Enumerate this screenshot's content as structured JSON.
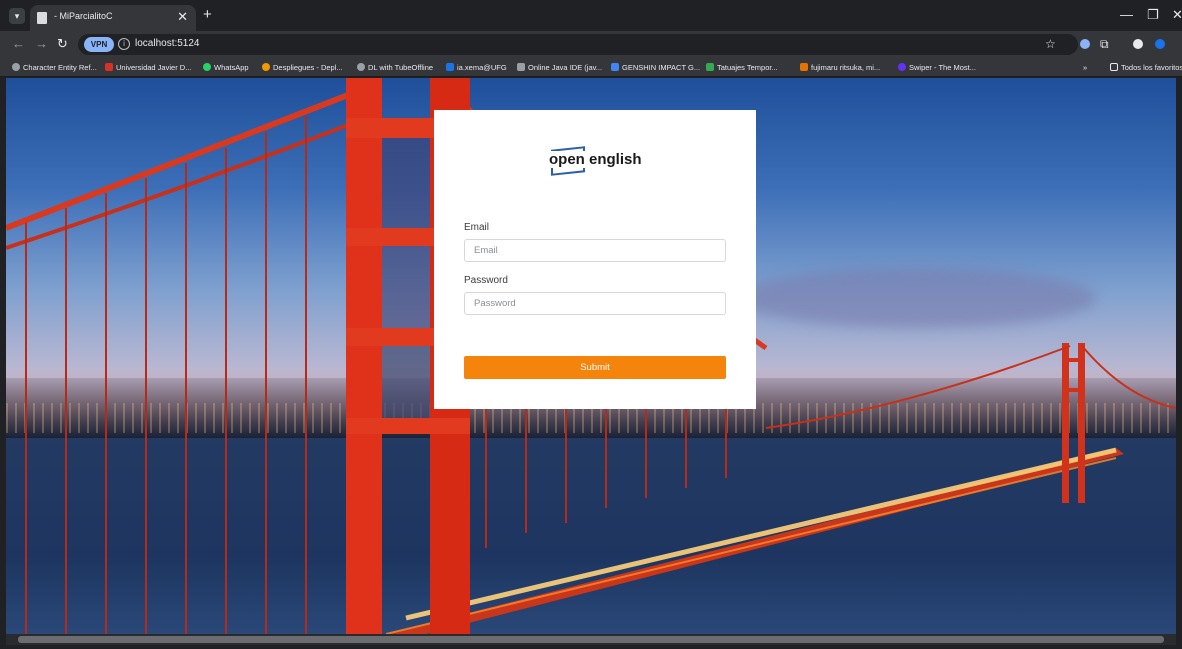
{
  "browser": {
    "tab": {
      "title": "- MiParcialitoC"
    },
    "address": {
      "vpn_label": "VPN",
      "url": "localhost:5124"
    },
    "bookmarks": [
      {
        "label": "Character Entity Ref...",
        "color": "#5f6368"
      },
      {
        "label": "Universidad Javier D...",
        "color": "#d93025"
      },
      {
        "label": "WhatsApp",
        "color": "#25d366"
      },
      {
        "label": "Despliegues - Depl...",
        "color": "#f29900"
      },
      {
        "label": "DL with TubeOffline",
        "color": "#5f6368"
      },
      {
        "label": "ia.xema@UFG",
        "color": "#1a73e8"
      },
      {
        "label": "Online Java IDE (jav...",
        "color": "#9aa0a6"
      },
      {
        "label": "GENSHIN IMPACT G...",
        "color": "#4285f4"
      },
      {
        "label": "Tatuajes Tempor...",
        "color": "#34a853"
      },
      {
        "label": "fujimaru ritsuka, mi...",
        "color": "#e37400"
      },
      {
        "label": "Swiper - The Most...",
        "color": "#6332f6"
      }
    ],
    "bookmarks_overflow": "»",
    "all_bookmarks": "Todos los favoritos"
  },
  "login": {
    "logo": {
      "word1": "open",
      "word2": "english"
    },
    "email": {
      "label": "Email",
      "placeholder": "Email",
      "value": ""
    },
    "password": {
      "label": "Password",
      "placeholder": "Password",
      "value": ""
    },
    "submit_label": "Submit",
    "accent_color": "#f5840c",
    "brand_color": "#2b5fa8"
  },
  "background": {
    "description_icon": "golden-gate-bridge-photo"
  }
}
